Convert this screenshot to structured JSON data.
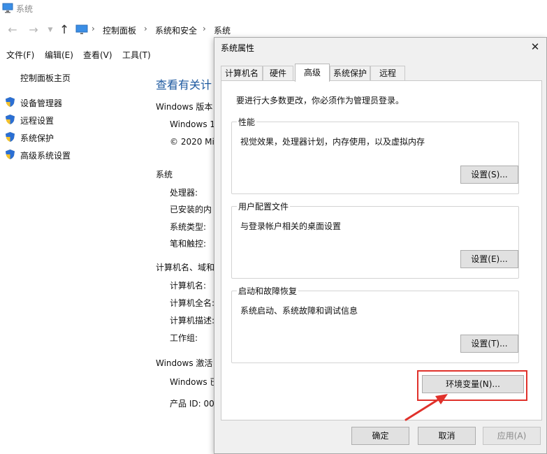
{
  "background_window": {
    "title": "系统",
    "breadcrumbs": [
      "控制面板",
      "系统和安全",
      "系统"
    ],
    "menu": [
      "文件(F)",
      "编辑(E)",
      "查看(V)",
      "工具(T)"
    ],
    "sidebar": {
      "home": "控制面板主页",
      "links": [
        "设备管理器",
        "远程设置",
        "系统保护",
        "高级系统设置"
      ]
    },
    "main": {
      "title": "查看有关计",
      "sections": [
        {
          "label": "Windows 版本",
          "rows": [
            "Windows 1",
            "© 2020 Mi"
          ]
        },
        {
          "label": "系统",
          "rows": [
            "处理器:",
            "已安装的内",
            "系统类型:",
            "笔和触控:"
          ]
        },
        {
          "label": "计算机名、域和",
          "rows": [
            "计算机名:",
            "计算机全名:",
            "计算机描述:",
            "工作组:"
          ]
        },
        {
          "label": "Windows 激活",
          "rows": [
            "Windows 已",
            "产品 ID: 00"
          ]
        }
      ]
    }
  },
  "dialog": {
    "title": "系统属性",
    "tabs": [
      "计算机名",
      "硬件",
      "高级",
      "系统保护",
      "远程"
    ],
    "active_tab": "高级",
    "admin_note": "要进行大多数更改，你必须作为管理员登录。",
    "groups": [
      {
        "title": "性能",
        "description": "视觉效果，处理器计划，内存使用，以及虚拟内存",
        "button": "设置(S)..."
      },
      {
        "title": "用户配置文件",
        "description": "与登录帐户相关的桌面设置",
        "button": "设置(E)..."
      },
      {
        "title": "启动和故障恢复",
        "description": "系统启动、系统故障和调试信息",
        "button": "设置(T)..."
      }
    ],
    "env_button": "环境变量(N)...",
    "footer": {
      "ok": "确定",
      "cancel": "取消",
      "apply": "应用(A)"
    }
  },
  "colors": {
    "accent": "#0078d7",
    "highlight": "#e0312b",
    "link_title": "#1e5aa0"
  }
}
